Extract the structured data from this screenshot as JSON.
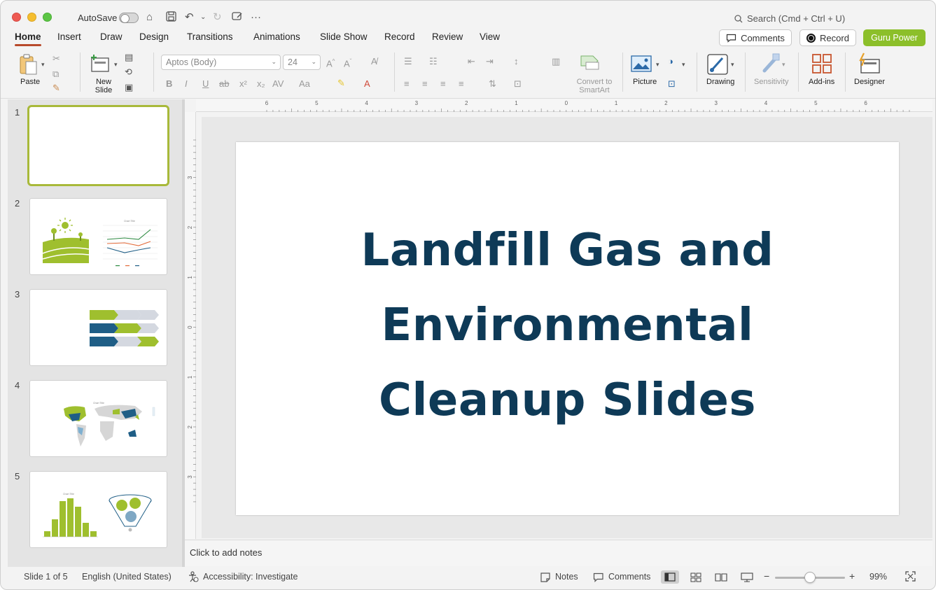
{
  "titlebar": {
    "autosave_label": "AutoSave",
    "search_placeholder": "Search (Cmd + Ctrl + U)"
  },
  "menu": {
    "tabs": [
      "Home",
      "Insert",
      "Draw",
      "Design",
      "Transitions",
      "Animations",
      "Slide Show",
      "Record",
      "Review",
      "View"
    ],
    "active_tab": "Home",
    "comments_label": "Comments",
    "record_label": "Record",
    "guru_label": "Guru Power"
  },
  "ribbon": {
    "paste_label": "Paste",
    "new_slide_label": [
      "New",
      "Slide"
    ],
    "font_name": "Aptos (Body)",
    "font_size": "24",
    "smartart_label": [
      "Convert to",
      "SmartArt"
    ],
    "picture_label": "Picture",
    "drawing_label": "Drawing",
    "sensitivity_label": "Sensitivity",
    "addins_label": "Add-ins",
    "designer_label": "Designer"
  },
  "slides": {
    "numbers": [
      "1",
      "2",
      "3",
      "4",
      "5"
    ],
    "thumb2_chart_title": "Chart Title",
    "thumb4_chart_title": "Chart Title",
    "thumb5_chart_title": "Chart Title"
  },
  "current_slide": {
    "title_lines": [
      "Landfill Gas and",
      "Environmental",
      "Cleanup Slides"
    ]
  },
  "notes": {
    "placeholder": "Click to add notes"
  },
  "ruler": {
    "h_labels": [
      "6",
      "5",
      "4",
      "3",
      "2",
      "1",
      "0",
      "1",
      "2",
      "3",
      "4",
      "5",
      "6"
    ],
    "v_labels": [
      "3",
      "2",
      "1",
      "0",
      "1",
      "2",
      "3"
    ]
  },
  "status": {
    "slide_counter": "Slide 1 of 5",
    "language": "English (United States)",
    "accessibility": "Accessibility: Investigate",
    "notes_label": "Notes",
    "comments_label": "Comments",
    "zoom_minus": "−",
    "zoom_plus": "+",
    "zoom_level": "99%"
  },
  "colors": {
    "accent": "#b84a2b",
    "brand_green": "#8cbf2a",
    "title_navy": "#0e3a57",
    "thumb_green": "#9fbf2e",
    "thumb_blue": "#1f5e86"
  }
}
